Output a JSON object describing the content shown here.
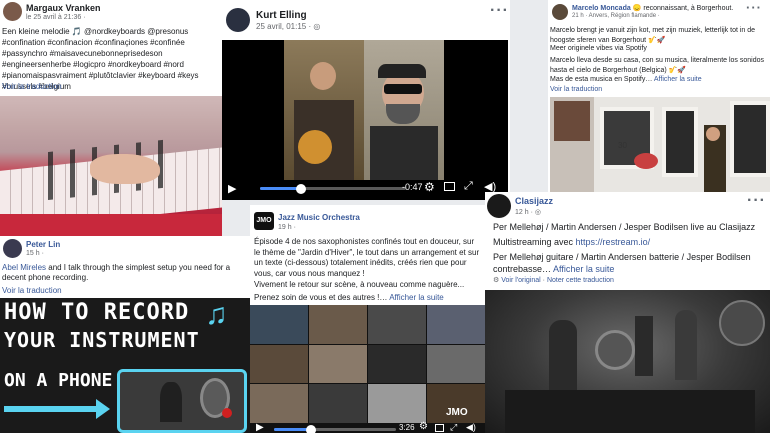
{
  "post1": {
    "author": "Margaux Vranken",
    "time": "le 25 avril à 21:36 ·",
    "text": "Een kleine melodie 🎵 @nordkeyboards @presonus #confination #confinacion #confinaçiones #confinée #passynchro #maisavecunebonneprisedeson #engineersenherbe #logicpro #nordkeyboard #nord #pianomaispasvraiment #plutôtclavier #keyboard #keys #brussels #belgium",
    "translate": "Voir la traduction"
  },
  "post2": {
    "author": "Kurt Elling",
    "time": "25 avril, 01:15 ·",
    "time_remaining": "-0:47",
    "progress": 0.28
  },
  "post3": {
    "author": "Marcelo Moncada",
    "action": "😞 reconnaissant, à Borgerhout.",
    "time": "21 h · Anvers, Région flamande ·",
    "text1": "Marcelo brengt je vanuit zijn kot, met zijn muziek, letterlijk tot in de hoogste sferen van Borgerhout 🎷🚀",
    "text2": "Meer originele vibes via Spotify",
    "text3": "Marcelo lleva desde su casa, con su musica, literalmente los sonidos hasta el cielo de Borgerhout (Belgica) 🎷🚀",
    "text4": "Mas de esta musica en Spotify…",
    "more": "Afficher la suite",
    "translate": "Voir la traduction"
  },
  "post4": {
    "author": "Peter Lin",
    "time": "15 h ·",
    "mention": "Abel Mireles",
    "text": " and I talk through the simplest setup you need for a decent phone recording.",
    "translate": "Voir la traduction",
    "thumb_line1": "HOW TO RECORD",
    "thumb_line2": "YOUR INSTRUMENT",
    "thumb_line3": "ON A PHONE"
  },
  "post5": {
    "author": "Jazz Music Orchestra",
    "time": "19 h ·",
    "logo": "JMO",
    "text1": "Épisode 4 de nos saxophonistes confinés tout en douceur, sur le thème de \"Jardin d'Hiver\", le tout dans un arrangement et sur un texte (ci-dessous) totalement inédits, créés rien que pour vous, car vous nous manquez !",
    "text2": "Vivement le retour sur scène, à nouveau comme naguère...",
    "text3": "Prenez soin de vous et des autres !…",
    "more": "Afficher la suite",
    "time_remaining": "3:26",
    "watermark": "JMO",
    "progress": 0.3
  },
  "post6": {
    "author": "Clasijazz",
    "time": "12 h ·",
    "text1": "Per Mellehøj / Martin Andersen / Jesper Bodilsen live au Clasijazz",
    "text2": "Multistreaming avec",
    "link": "https://restream.io/",
    "text3": "Per Mellehøj guitare / Martin Andersen batterie / Jesper Bodilsen contrebasse…",
    "more": "Afficher la suite",
    "original": "Voir l'original",
    "rate": "Noter cette traduction"
  },
  "colors": {
    "fb_link": "#385898",
    "meta": "#65676b",
    "piano_red": "#c8283c",
    "progress_blue": "#4a8cf7"
  }
}
